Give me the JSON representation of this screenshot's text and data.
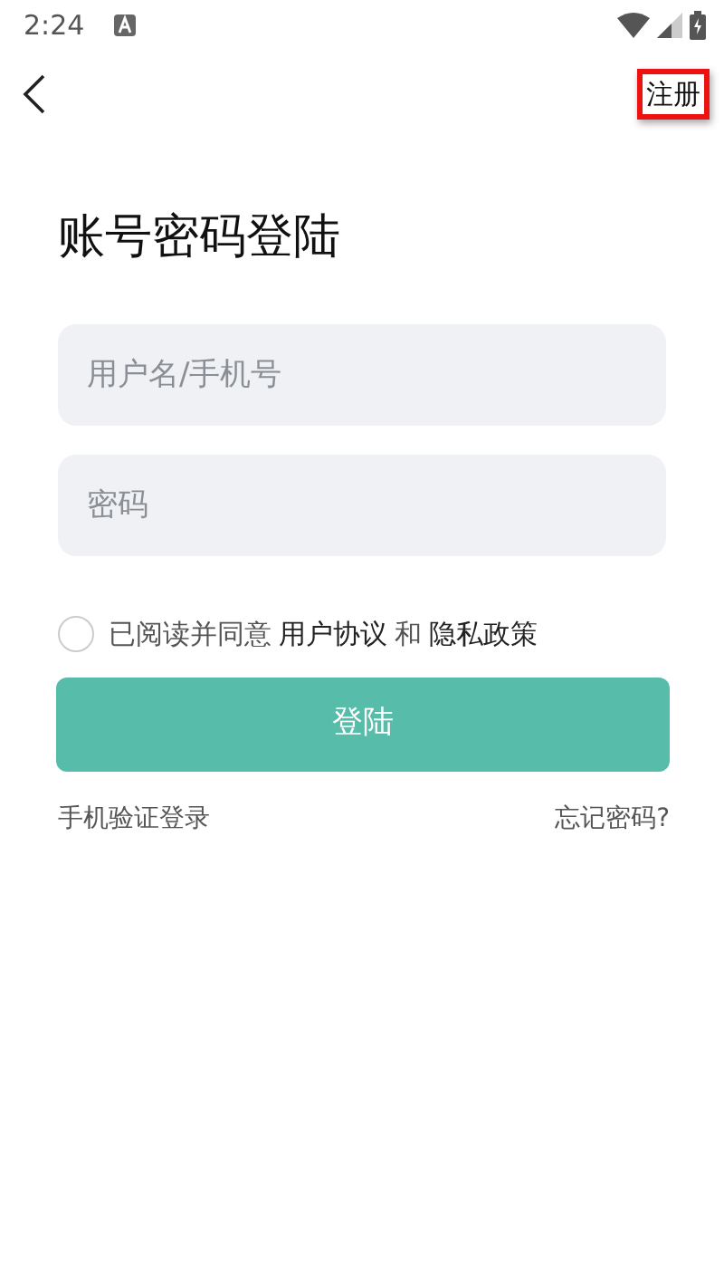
{
  "status_bar": {
    "time": "2:24"
  },
  "header": {
    "register": "注册"
  },
  "title": "账号密码登陆",
  "fields": [
    {
      "placeholder": "用户名/手机号"
    },
    {
      "placeholder": "密码"
    }
  ],
  "agreement": {
    "checked": false,
    "prefix": "已阅读并同意",
    "terms": "用户协议",
    "and": "和",
    "privacy": "隐私政策"
  },
  "login_button": "登陆",
  "links": {
    "sms_login": "手机验证登录",
    "forgot": "忘记密码?"
  }
}
